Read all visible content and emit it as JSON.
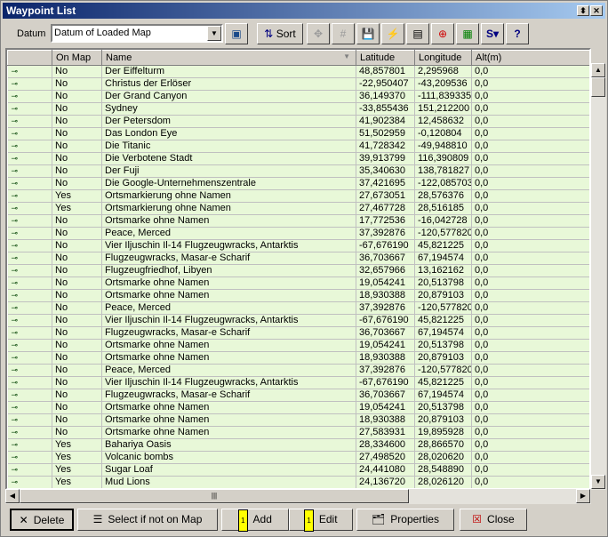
{
  "window": {
    "title": "Waypoint List"
  },
  "toolbar": {
    "datum_label": "Datum",
    "datum_value": "Datum of Loaded Map",
    "sort_label": "Sort"
  },
  "columns": [
    "",
    "On Map",
    "Name",
    "Latitude",
    "Longitude",
    "Alt(m)"
  ],
  "rows": [
    [
      "No",
      "Der Eiffelturm",
      "48,857801",
      "2,295968",
      "0,0"
    ],
    [
      "No",
      "Christus der Erlöser",
      "-22,950407",
      "-43,209536",
      "0,0"
    ],
    [
      "No",
      "Der Grand Canyon",
      "36,149370",
      "-111,839335",
      "0,0"
    ],
    [
      "No",
      "Sydney",
      "-33,855436",
      "151,212200",
      "0,0"
    ],
    [
      "No",
      "Der Petersdom",
      "41,902384",
      "12,458632",
      "0,0"
    ],
    [
      "No",
      "Das London Eye",
      "51,502959",
      "-0,120804",
      "0,0"
    ],
    [
      "No",
      "Die Titanic",
      "41,728342",
      "-49,948810",
      "0,0"
    ],
    [
      "No",
      "Die Verbotene Stadt",
      "39,913799",
      "116,390809",
      "0,0"
    ],
    [
      "No",
      "Der Fuji",
      "35,340630",
      "138,781827",
      "0,0"
    ],
    [
      "No",
      "Die Google-Unternehmenszentrale",
      "37,421695",
      "-122,085703",
      "0,0"
    ],
    [
      "Yes",
      "Ortsmarkierung ohne Namen",
      "27,673051",
      "28,576376",
      "0,0"
    ],
    [
      "Yes",
      "Ortsmarkierung ohne Namen",
      "27,467728",
      "28,516185",
      "0,0"
    ],
    [
      "No",
      "Ortsmarke ohne Namen",
      "17,772536",
      "-16,042728",
      "0,0"
    ],
    [
      "No",
      "Peace, Merced",
      "37,392876",
      "-120,577820",
      "0,0"
    ],
    [
      "No",
      "Vier Iljuschin Il-14 Flugzeugwracks, Antarktis",
      "-67,676190",
      "45,821225",
      "0,0"
    ],
    [
      "No",
      "Flugzeugwracks, Masar-e Scharif",
      "36,703667",
      "67,194574",
      "0,0"
    ],
    [
      "No",
      "Flugzeugfriedhof, Libyen",
      "32,657966",
      "13,162162",
      "0,0"
    ],
    [
      "No",
      "Ortsmarke ohne Namen",
      "19,054241",
      "20,513798",
      "0,0"
    ],
    [
      "No",
      "Ortsmarke ohne Namen",
      "18,930388",
      "20,879103",
      "0,0"
    ],
    [
      "No",
      "Peace, Merced",
      "37,392876",
      "-120,577820",
      "0,0"
    ],
    [
      "No",
      "Vier Iljuschin Il-14 Flugzeugwracks, Antarktis",
      "-67,676190",
      "45,821225",
      "0,0"
    ],
    [
      "No",
      "Flugzeugwracks, Masar-e Scharif",
      "36,703667",
      "67,194574",
      "0,0"
    ],
    [
      "No",
      "Ortsmarke ohne Namen",
      "19,054241",
      "20,513798",
      "0,0"
    ],
    [
      "No",
      "Ortsmarke ohne Namen",
      "18,930388",
      "20,879103",
      "0,0"
    ],
    [
      "No",
      "Peace, Merced",
      "37,392876",
      "-120,577820",
      "0,0"
    ],
    [
      "No",
      "Vier Iljuschin Il-14 Flugzeugwracks, Antarktis",
      "-67,676190",
      "45,821225",
      "0,0"
    ],
    [
      "No",
      "Flugzeugwracks, Masar-e Scharif",
      "36,703667",
      "67,194574",
      "0,0"
    ],
    [
      "No",
      "Ortsmarke ohne Namen",
      "19,054241",
      "20,513798",
      "0,0"
    ],
    [
      "No",
      "Ortsmarke ohne Namen",
      "18,930388",
      "20,879103",
      "0,0"
    ],
    [
      "No",
      "Ortsmarke ohne Namen",
      "27,583931",
      "19,895928",
      "0,0"
    ],
    [
      "Yes",
      "Bahariya Oasis",
      "28,334600",
      "28,866570",
      "0,0"
    ],
    [
      "Yes",
      "Volcanic bombs",
      "27,498520",
      "28,020620",
      "0,0"
    ],
    [
      "Yes",
      "Sugar Loaf",
      "24,441080",
      "28,548890",
      "0,0"
    ],
    [
      "Yes",
      "Mud Lions",
      "24,136720",
      "28,026120",
      "0,0"
    ]
  ],
  "buttons": {
    "delete": "Delete",
    "select_if_not_on_map": "Select if not on Map",
    "add": "Add",
    "edit": "Edit",
    "properties": "Properties",
    "close": "Close"
  }
}
